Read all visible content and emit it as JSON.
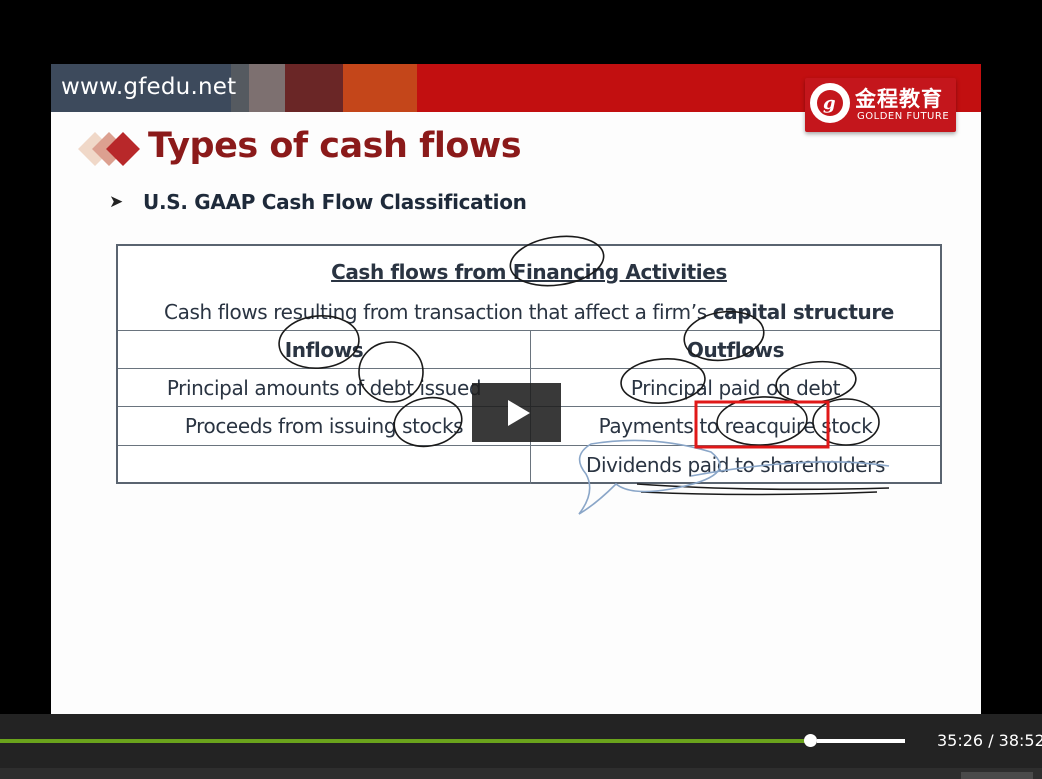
{
  "header": {
    "site_url": "www.gfedu.net",
    "band_colors": [
      "#3d4a5c",
      "#7d7070",
      "#6a2626",
      "#c4461a",
      "#c20f10"
    ],
    "logo": {
      "seal_letter": "g",
      "seal_ring_text": "GOLDEN FUTURE EDUCATION",
      "name_cn": "金程教育",
      "name_en": "GOLDEN FUTURE",
      "color": "#c4161c"
    }
  },
  "slide": {
    "title": "Types of cash flows",
    "subtitle_bullet": "➤",
    "subtitle": "U.S. GAAP Cash Flow Classification",
    "title_color": "#8b1a1a"
  },
  "table": {
    "heading": "Cash flows from Financing Activities",
    "description_prefix": "Cash flows resulting from transaction that affect a firm’s ",
    "description_bold": "capital structure",
    "columns": {
      "left": "Inflows",
      "right": "Outflows"
    },
    "rows": [
      {
        "left": "Principal amounts of debt issued",
        "right": "Principal paid on debt"
      },
      {
        "left": "Proceeds from issuing stocks",
        "right": "Payments to reacquire stock"
      },
      {
        "left": "",
        "right": "Dividends paid to shareholders"
      }
    ]
  },
  "player": {
    "play_icon": "play-icon",
    "time_current": "35:26",
    "time_separator": " / ",
    "time_total": "38:52",
    "progress_fraction": 0.911,
    "progress_color": "#6aa31c"
  }
}
